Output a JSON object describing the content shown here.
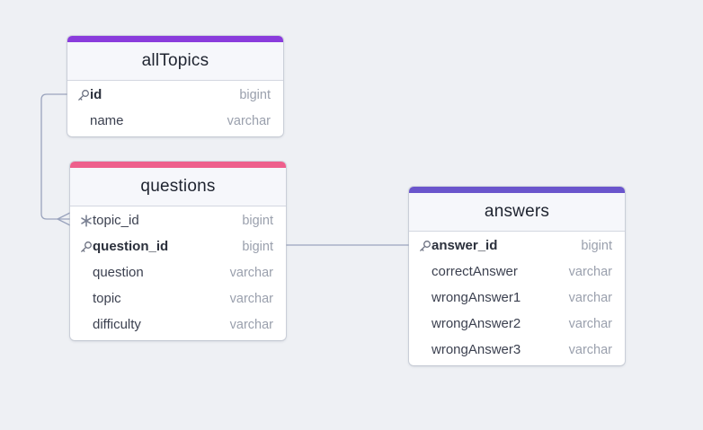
{
  "colors": {
    "background": "#eef0f4",
    "connector": "#9aa3bd",
    "allTopics_accent": "#8a3cdc",
    "questions_accent": "#ee5f8c",
    "answers_accent": "#6a55cc"
  },
  "tables": {
    "allTopics": {
      "title": "allTopics",
      "fields": [
        {
          "name": "id",
          "type": "bigint",
          "icon": "key-icon"
        },
        {
          "name": "name",
          "type": "varchar",
          "icon": ""
        }
      ]
    },
    "questions": {
      "title": "questions",
      "fields": [
        {
          "name": "topic_id",
          "type": "bigint",
          "icon": "snowflake-icon"
        },
        {
          "name": "question_id",
          "type": "bigint",
          "icon": "key-icon"
        },
        {
          "name": "question",
          "type": "varchar",
          "icon": ""
        },
        {
          "name": "topic",
          "type": "varchar",
          "icon": ""
        },
        {
          "name": "difficulty",
          "type": "varchar",
          "icon": ""
        }
      ]
    },
    "answers": {
      "title": "answers",
      "fields": [
        {
          "name": "answer_id",
          "type": "bigint",
          "icon": "key-icon"
        },
        {
          "name": "correctAnswer",
          "type": "varchar",
          "icon": ""
        },
        {
          "name": "wrongAnswer1",
          "type": "varchar",
          "icon": ""
        },
        {
          "name": "wrongAnswer2",
          "type": "varchar",
          "icon": ""
        },
        {
          "name": "wrongAnswer3",
          "type": "varchar",
          "icon": ""
        }
      ]
    }
  }
}
